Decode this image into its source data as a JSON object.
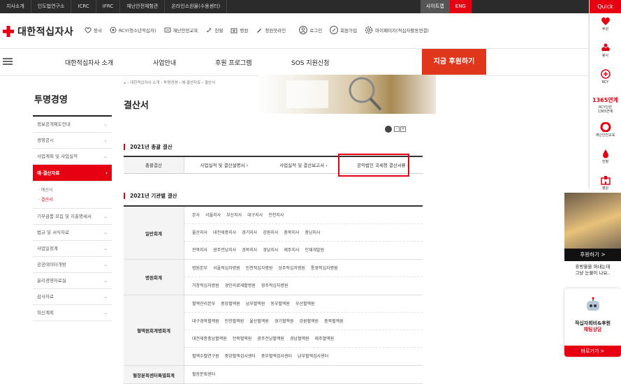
{
  "topbar": {
    "links": [
      "지사소개",
      "인도법연구소",
      "ICRC",
      "IFRC",
      "재난안전체험관",
      "온라인소원물(수용센터)"
    ],
    "sitemap": "사이트맵",
    "eng": "ENG"
  },
  "quick": {
    "title": "Quick",
    "items": [
      {
        "label": "후원",
        "icon": "heart-hands-icon"
      },
      {
        "label": "봉사",
        "icon": "helping-hands-icon"
      },
      {
        "label": "RCY",
        "icon": "rcy-icon"
      },
      {
        "label": "RCY단원\n1365연계",
        "big": "1365연계",
        "icon": "rcy-1365-icon"
      },
      {
        "label": "재난안전교육",
        "icon": "lifebuoy-icon"
      },
      {
        "label": "헌혈",
        "icon": "blood-drop-icon"
      },
      {
        "label": "병원",
        "icon": "hospital-icon"
      }
    ]
  },
  "header": {
    "logo_text": "대한적십자사",
    "links": [
      {
        "label": "봉사",
        "icon": "heart-hand-icon"
      },
      {
        "label": "RCY(청소년적십자)",
        "icon": "rcy-icon"
      },
      {
        "label": "재난안전교육",
        "icon": "safety-icon"
      },
      {
        "label": "헌혈",
        "icon": "blood-icon"
      },
      {
        "label": "병원",
        "icon": "hospital-icon"
      },
      {
        "label": "청원웃라인",
        "icon": "pen-icon"
      }
    ],
    "login": "로그인",
    "join": "회원가입",
    "mypage": "마이페이지(적십자활동연결)"
  },
  "gnb": {
    "items": [
      "대한적십자사 소개",
      "사업안내",
      "후원 프로그램",
      "SOS 지원신청"
    ],
    "donate": "지금 후원하기"
  },
  "lnb": {
    "title": "투명경영",
    "items_before": [
      "정보공개제도안내",
      "경영공시",
      "사업계획 및 사업실적"
    ],
    "active": "예·결산자료",
    "sub": [
      "예산서",
      "결산서"
    ],
    "sub_active_index": 1,
    "items_after": [
      "기부금품 모집 및 지출명세서",
      "법규 및 서식자료",
      "사업일정계",
      "공공데이터개방",
      "윤리경영자료실",
      "감사자료",
      "혁신계획"
    ]
  },
  "breadcrumb": {
    "items": [
      "대한적십자사 소개",
      "투명경영",
      "예·결산자료",
      "결산서"
    ]
  },
  "page_title": "결산서",
  "util": {
    "print": "print-icon",
    "minus": "-",
    "plus": "+"
  },
  "section1": {
    "title": "2021년 총괄 결산",
    "head": "총괄결산",
    "links": [
      "사업실적 및 결산설명서",
      "사업실적 및 결산보고서",
      "공익법인 국세청 결산서류"
    ]
  },
  "section2": {
    "title": "2021년 기관별 결산",
    "groups": [
      {
        "head": "일반회계",
        "rows": [
          [
            "본사",
            "서울지사",
            "부산지사",
            "대구지사",
            "인천지사"
          ],
          [
            "울산지사",
            "대전세종지사",
            "경기지사",
            "강원지사",
            "충북지사",
            "충남지사"
          ],
          [
            "전북지사",
            "광주전남지사",
            "경북지사",
            "경남지사",
            "제주지사",
            "인재개발원"
          ]
        ]
      },
      {
        "head": "병원회계",
        "rows": [
          [
            "병원본부",
            "서울적십자병원",
            "인천적십자병원",
            "상주적십자병원",
            "통영적십자병원"
          ],
          [
            "거창적십자병원",
            "경인의료재활병원",
            "영주적십자병원"
          ]
        ]
      },
      {
        "head": "혈액원회계병회계",
        "rows": [
          [
            "혈액관리본부",
            "중앙혈액원",
            "남부혈액원",
            "동부혈액원",
            "부산혈액원"
          ],
          [
            "대구경북혈액원",
            "인천혈액원",
            "울산혈액원",
            "경기혈액원",
            "강원혈액원",
            "충북혈액원"
          ],
          [
            "대전세종충남혈액원",
            "전북혈액원",
            "광주전남혈액원",
            "경남혈액원",
            "제주혈액원"
          ],
          [
            "혈액수혈연구원",
            "중앙혈액검사센터",
            "중부혈액검사센터",
            "남부혈액검사센터"
          ]
        ]
      },
      {
        "head": "혈장분획센터특별회계",
        "rows": [
          [
            "혈장분획센터"
          ]
        ]
      }
    ]
  },
  "side_ad": {
    "caption": "후원하기 >",
    "text": "휴방울을 퍼내는데\n그냥 눈물이 나요.."
  },
  "side_chat": {
    "line1": "적십자회비&후원",
    "line2": "채팅상담",
    "button": "바로가기 >"
  },
  "colors": {
    "brand": "#e60012",
    "donate": "#e0361c",
    "topbar": "#2b2b2b"
  }
}
